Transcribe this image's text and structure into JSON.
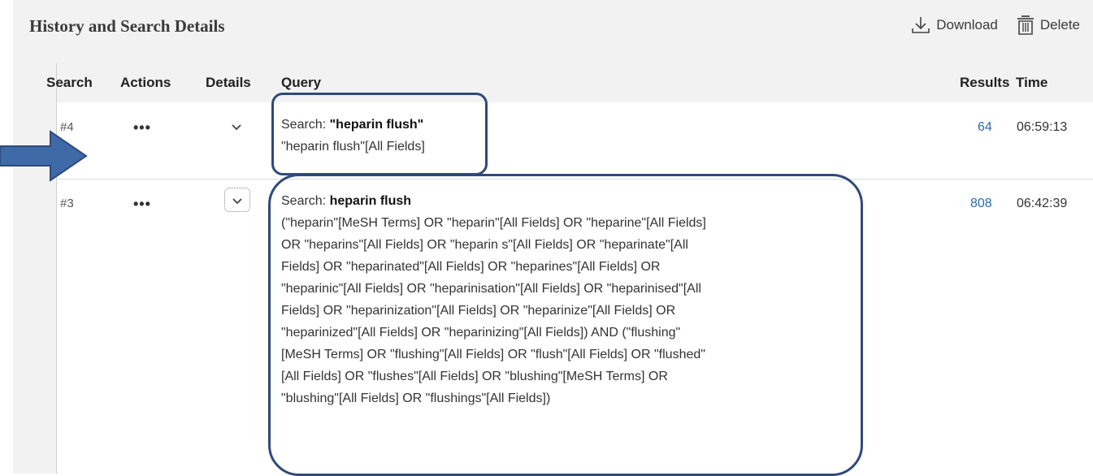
{
  "panel": {
    "title": "History and Search Details",
    "download_label": "Download",
    "delete_label": "Delete"
  },
  "columns": {
    "search": "Search",
    "actions": "Actions",
    "details": "Details",
    "query": "Query",
    "results": "Results",
    "time": "Time"
  },
  "rows": [
    {
      "number": "#4",
      "actions": "•••",
      "query_prefix": "Search: ",
      "query_term": "\"heparin flush\"",
      "details": "\"heparin flush\"[All Fields]",
      "results": "64",
      "time": "06:59:13"
    },
    {
      "number": "#3",
      "actions": "•••",
      "query_prefix": "Search: ",
      "query_term": "heparin flush",
      "details_lines": [
        "(\"heparin\"[MeSH Terms] OR \"heparin\"[All Fields] OR \"heparine\"[All Fields]",
        "OR \"heparins\"[All Fields] OR \"heparin s\"[All Fields] OR \"heparinate\"[All",
        "Fields] OR \"heparinated\"[All Fields] OR \"heparines\"[All Fields] OR",
        "\"heparinic\"[All Fields] OR \"heparinisation\"[All Fields] OR \"heparinised\"[All",
        "Fields] OR \"heparinization\"[All Fields] OR \"heparinize\"[All Fields] OR",
        "\"heparinized\"[All Fields] OR \"heparinizing\"[All Fields]) AND (\"flushing\"",
        "[MeSH Terms] OR \"flushing\"[All Fields] OR \"flush\"[All Fields] OR \"flushed\"",
        "[All Fields] OR \"flushes\"[All Fields] OR \"blushing\"[MeSH Terms] OR",
        "\"blushing\"[All Fields] OR \"flushings\"[All Fields])"
      ],
      "results": "808",
      "time": "06:42:39"
    }
  ],
  "colors": {
    "highlight_border": "#2f4a7a",
    "arrow_fill": "#3e6aa8",
    "link": "#2a6bb0"
  },
  "icons": [
    "download-icon",
    "trash-icon",
    "chevron-down-icon",
    "arrow-right-icon"
  ]
}
